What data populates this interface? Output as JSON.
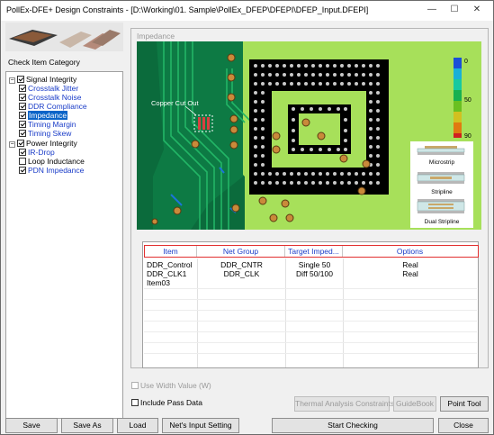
{
  "window": {
    "title": "PollEx-DFE+ Design Constraints - [D:\\Working\\01. Sample\\PollEx_DFEP\\DFEPI\\DFEP_Input.DFEPI]"
  },
  "window_controls": {
    "minimize": "—",
    "maximize": "☐",
    "close": "✕"
  },
  "left": {
    "category_label": "Check Item Category",
    "tree": [
      {
        "label": "Signal Integrity",
        "checked": true,
        "expanded": true,
        "level": 0
      },
      {
        "label": "Crosstalk Jitter",
        "checked": true,
        "level": 1
      },
      {
        "label": "Crosstalk Noise",
        "checked": true,
        "level": 1
      },
      {
        "label": "DDR Compliance",
        "checked": true,
        "level": 1
      },
      {
        "label": "Impedance",
        "checked": true,
        "level": 1,
        "selected": true
      },
      {
        "label": "Timing Margin",
        "checked": true,
        "level": 1
      },
      {
        "label": "Timing Skew",
        "checked": true,
        "level": 1
      },
      {
        "label": "Power Integrity",
        "checked": true,
        "expanded": true,
        "level": 0
      },
      {
        "label": "IR-Drop",
        "checked": true,
        "level": 1
      },
      {
        "label": "Loop Inductance",
        "checked": false,
        "level": 1
      },
      {
        "label": "PDN Impedance",
        "checked": true,
        "level": 1
      }
    ]
  },
  "panel": {
    "title": "Impedance",
    "board": {
      "annotation": "Copper Cut Out",
      "colors": {
        "board": "#a7e05a",
        "copper": "#0b6b3c",
        "trace": "#0f9a55",
        "hole": "#000000",
        "pad": "#c98a3a"
      },
      "scale": {
        "top": "0",
        "mid": "50",
        "bottom": "90"
      },
      "legend": [
        "Microstrip",
        "Stripline",
        "Dual Stripline"
      ]
    },
    "table": {
      "columns": [
        "Item",
        "Net Group",
        "Target Imped...",
        "Options"
      ],
      "rows": [
        [
          "DDR_Control",
          "DDR_CNTR",
          "Single 50",
          "Real"
        ],
        [
          "DDR_CLK1",
          "DDR_CLK",
          "Diff 50/100",
          "Real"
        ],
        [
          "Item03",
          "",
          "",
          ""
        ]
      ]
    }
  },
  "options": {
    "use_width_value": "Use Width Value (W)",
    "include_pass_data": "Include Pass Data",
    "thermal_button": "Thermal Analysis Constraints",
    "guidebook_button": "GuideBook",
    "point_tool_button": "Point Tool"
  },
  "bottom": {
    "save": "Save",
    "save_as": "Save As",
    "load": "Load",
    "nets_input": "Net's Input Setting",
    "start": "Start Checking",
    "close": "Close"
  }
}
